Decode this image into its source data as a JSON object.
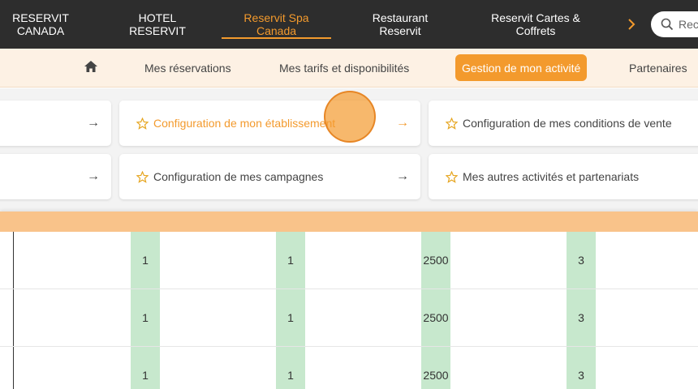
{
  "top_nav": {
    "tabs": [
      {
        "label": "RESERVIT\nCANADA"
      },
      {
        "label": "HOTEL\nRESERVIT"
      },
      {
        "label": "Reservit Spa\nCanada"
      },
      {
        "label": "Restaurant\nReservit"
      },
      {
        "label": "Reservit Cartes &\nCoffrets"
      }
    ],
    "active_tab": "Reservit Spa Canada",
    "next_icon": "chevron-right-icon",
    "search": {
      "placeholder": "Rechercher",
      "icon": "search-icon"
    }
  },
  "sub_nav": {
    "home_icon": "home-icon",
    "tabs": [
      {
        "label": "Mes réservations"
      },
      {
        "label": "Mes tarifs et disponibilités"
      },
      {
        "label": "Gestion de mon activité"
      },
      {
        "label": "Partenaires"
      }
    ],
    "active_tab": "Gestion de mon activité"
  },
  "menu_cards": [
    {
      "label": "Configuration de mon établissement",
      "icon": "star-icon",
      "active": true
    },
    {
      "label": "Configuration de mes conditions de vente",
      "icon": "star-icon",
      "active": false
    },
    {
      "label": "Configuration de mes campagnes",
      "icon": "star-icon",
      "active": false
    },
    {
      "label": "Mes autres activités et partenariats",
      "icon": "star-icon",
      "active": false
    }
  ],
  "table": {
    "rows": [
      [
        "1",
        "1",
        "2500",
        "3"
      ],
      [
        "1",
        "1",
        "2500",
        "3"
      ],
      [
        "1",
        "1",
        "2500",
        "3"
      ]
    ]
  },
  "colors": {
    "accent": "#f39a2d",
    "top_bar": "#2d2d2d",
    "sub_bar": "#fdf1e4",
    "band": "#f9c38a",
    "highlight_column": "#c7e8cd"
  }
}
